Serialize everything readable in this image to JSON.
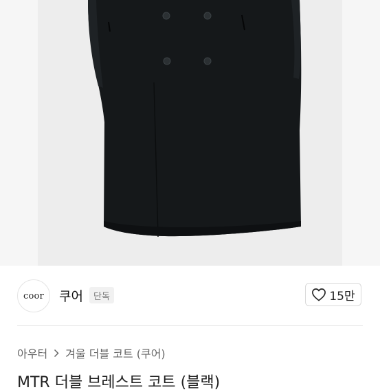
{
  "product_image": {
    "description_icon": "coat-photo",
    "background": "#ededed",
    "coat_color": "#15181a"
  },
  "brand": {
    "logo_text": "coor",
    "name": "쿠어",
    "badge": "단독"
  },
  "like": {
    "icon": "heart-outline-icon",
    "count": "15만"
  },
  "breadcrumb": {
    "level1": "아우터",
    "separator_icon": "chevron-right-icon",
    "level2": "겨울 더블 코트 (쿠어)"
  },
  "product": {
    "title": "MTR 더블 브레스트 코트 (블랙)"
  }
}
